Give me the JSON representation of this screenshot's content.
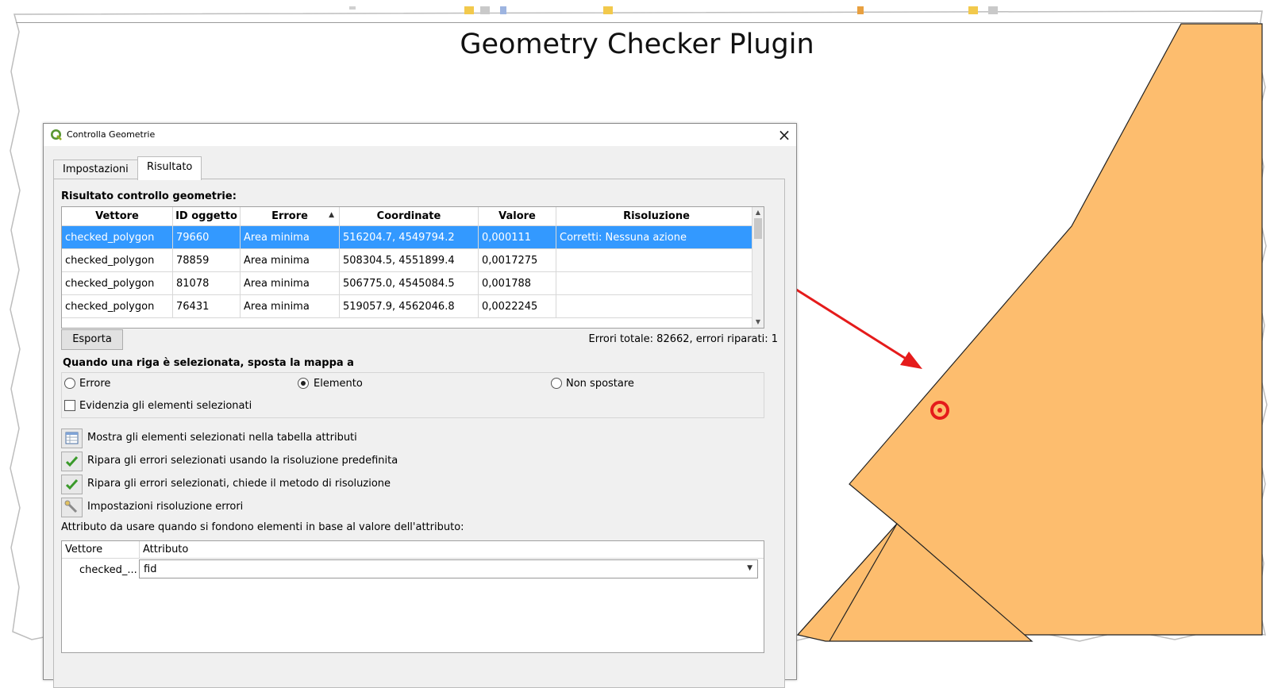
{
  "slide": {
    "title": "Geometry Checker Plugin"
  },
  "colors": {
    "polygon_fill": "#fdbd6e",
    "selection": "#3399ff",
    "arrow": "#e51b1b"
  },
  "dialog": {
    "title": "Controlla Geometrie",
    "tabs": [
      "Impostazioni",
      "Risultato"
    ],
    "active_tab": "Risultato",
    "results_label": "Risultato controllo geometrie:",
    "table": {
      "columns": [
        "Vettore",
        "ID oggetto",
        "Errore",
        "Coordinate",
        "Valore",
        "Risoluzione"
      ],
      "sorted_column": "Errore",
      "rows": [
        {
          "vettore": "checked_polygon",
          "id": "79660",
          "errore": "Area minima",
          "coordinate": "516204.7, 4549794.2",
          "valore": "0,000111",
          "risoluzione": "Corretti: Nessuna azione",
          "selected": true
        },
        {
          "vettore": "checked_polygon",
          "id": "78859",
          "errore": "Area minima",
          "coordinate": "508304.5, 4551899.4",
          "valore": "0,0017275",
          "risoluzione": "",
          "selected": false
        },
        {
          "vettore": "checked_polygon",
          "id": "81078",
          "errore": "Area minima",
          "coordinate": "506775.0, 4545084.5",
          "valore": "0,001788",
          "risoluzione": "",
          "selected": false
        },
        {
          "vettore": "checked_polygon",
          "id": "76431",
          "errore": "Area minima",
          "coordinate": "519057.9, 4562046.8",
          "valore": "0,0022245",
          "risoluzione": "",
          "selected": false
        }
      ]
    },
    "export_label": "Esporta",
    "errors_summary": "Errori totale: 82662, errori riparati: 1",
    "move_map_label": "Quando una riga è selezionata, sposta la mappa a",
    "move_options": [
      "Errore",
      "Elemento",
      "Non spostare"
    ],
    "move_selected": "Elemento",
    "highlight_label": "Evidenzia gli elementi selezionati",
    "highlight_checked": false,
    "tools": [
      {
        "label": "Mostra gli elementi selezionati nella tabella attributi",
        "icon": "attribute-table-icon"
      },
      {
        "label": "Ripara gli errori selezionati usando la risoluzione predefinita",
        "icon": "checkmark-icon"
      },
      {
        "label": "Ripara gli errori selezionati, chiede il metodo di risoluzione",
        "icon": "checkmark-icon"
      },
      {
        "label": "Impostazioni risoluzione errori",
        "icon": "wrench-icon"
      }
    ],
    "merge_attr_label": "Attributo da usare quando si fondono elementi in base al valore dell'attributo:",
    "merge_table": {
      "columns": [
        "Vettore",
        "Attributo"
      ],
      "layer": "checked_...",
      "attribute": "fid"
    }
  }
}
